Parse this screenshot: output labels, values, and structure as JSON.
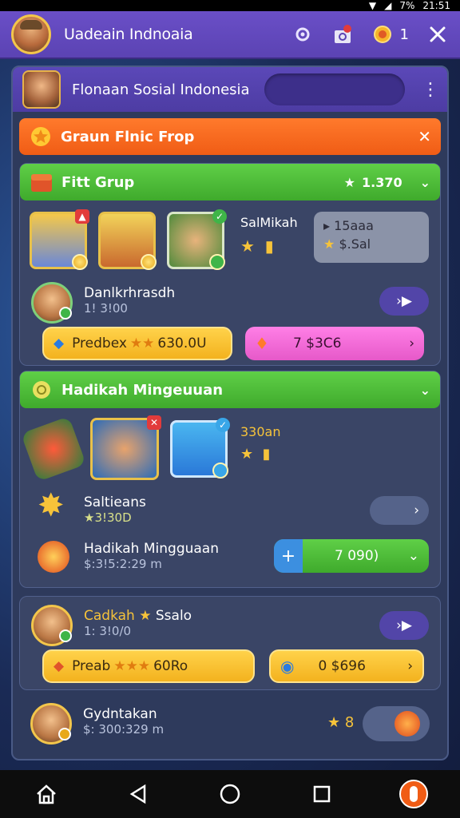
{
  "status_bar": {
    "battery": "7%",
    "time": "21:51"
  },
  "app_bar": {
    "title": "Uadeain Indnoaia",
    "notification_count": "1"
  },
  "panel_header": {
    "title": "Flonaan Sosial Indonesia"
  },
  "sections": {
    "group_banner": {
      "label": "Graun Flnic Frop"
    },
    "fitt_grup": {
      "label": "Fitt Grup",
      "score": "1.370",
      "tile_text": "SalMikah",
      "reward_box": {
        "line1": "15aaa",
        "line2": "$.Sal"
      }
    },
    "player1": {
      "name": "Danlkrhrasdh",
      "sub": "1! 3!00",
      "yellow_pill": "Predbex",
      "yellow_pill_value": "630.0U",
      "pink_pill": "7 $3C6"
    },
    "weekly": {
      "label": "Hadikah Mingeuuan",
      "tile_text": "330an"
    },
    "salliens": {
      "name": "Saltieans",
      "sub": "3!30D"
    },
    "hadikah_row": {
      "name": "Hadikah Mingguaan",
      "sub": "$:3!5:2:29 m",
      "green_pill": "7 090)"
    },
    "card2": {
      "name": "Cadkah",
      "name_suffix": "Ssalo",
      "sub": "1: 3!0/0",
      "yellow_pill": "Preab",
      "yellow_pill_value": "60Ro",
      "yellow_pill2": "0 $696"
    },
    "card3": {
      "name": "Gydntakan",
      "sub": "$: 300:329 m",
      "value": "8"
    }
  },
  "colors": {
    "app_bar": "#5b43b3",
    "orange_banner": "#f05c15",
    "green_banner": "#3faa2c",
    "yellow_pill": "#f3b21e",
    "pink_pill": "#e659c9"
  }
}
